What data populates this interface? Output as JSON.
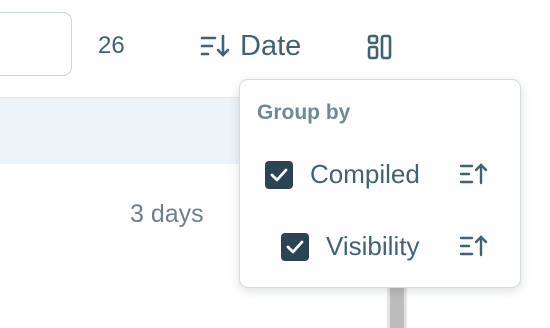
{
  "toolbar": {
    "count": "26",
    "sort_label": "Date",
    "sort_icon": "sort-descending-icon",
    "layout_icon": "layout-grid-icon"
  },
  "list": {
    "row_age": "3 days"
  },
  "group_by": {
    "title": "Group by",
    "items": [
      {
        "label": "Compiled",
        "checked": true,
        "sort_icon": "sort-ascending-icon"
      },
      {
        "label": "Visibility",
        "checked": true,
        "sort_icon": "sort-ascending-icon"
      }
    ]
  },
  "colors": {
    "text": "#3f6374",
    "checkbox": "#2c4452",
    "band": "#edf4f9"
  }
}
